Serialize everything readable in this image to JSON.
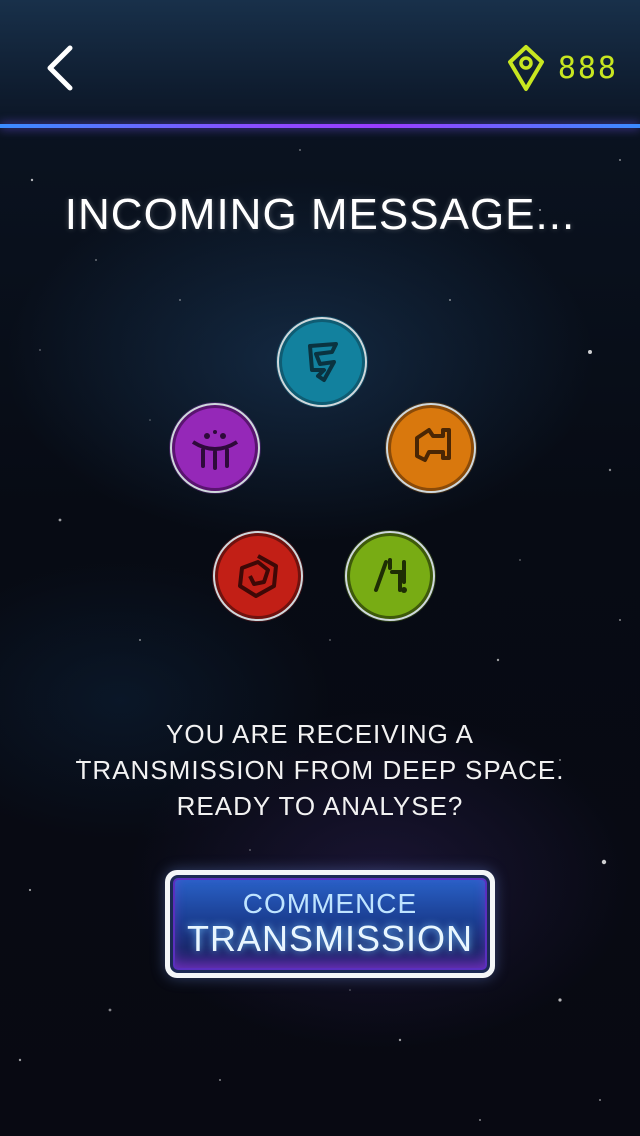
{
  "header": {
    "back_icon": "chevron-left-icon",
    "currency_icon": "gem-marker-icon",
    "currency_value": "888",
    "currency_color": "#c8e620"
  },
  "title": "INCOMING MESSAGE...",
  "emblems": [
    {
      "name": "cyan-glyph-emblem",
      "color": "#1fb8d6"
    },
    {
      "name": "orange-glyph-emblem",
      "color": "#f08a12"
    },
    {
      "name": "purple-glyph-emblem",
      "color": "#b03cd8"
    },
    {
      "name": "red-glyph-emblem",
      "color": "#e0271e"
    },
    {
      "name": "green-glyph-emblem",
      "color": "#8cc61a"
    }
  ],
  "message": {
    "line1": "YOU ARE RECEIVING A",
    "line2": "TRANSMISSION FROM DEEP SPACE.",
    "line3": "READY TO ANALYSE?"
  },
  "cta": {
    "line1": "COMMENCE",
    "line2": "TRANSMISSION"
  },
  "colors": {
    "accent_line": "#8a4dff",
    "button_blue": "#2a62c9"
  }
}
